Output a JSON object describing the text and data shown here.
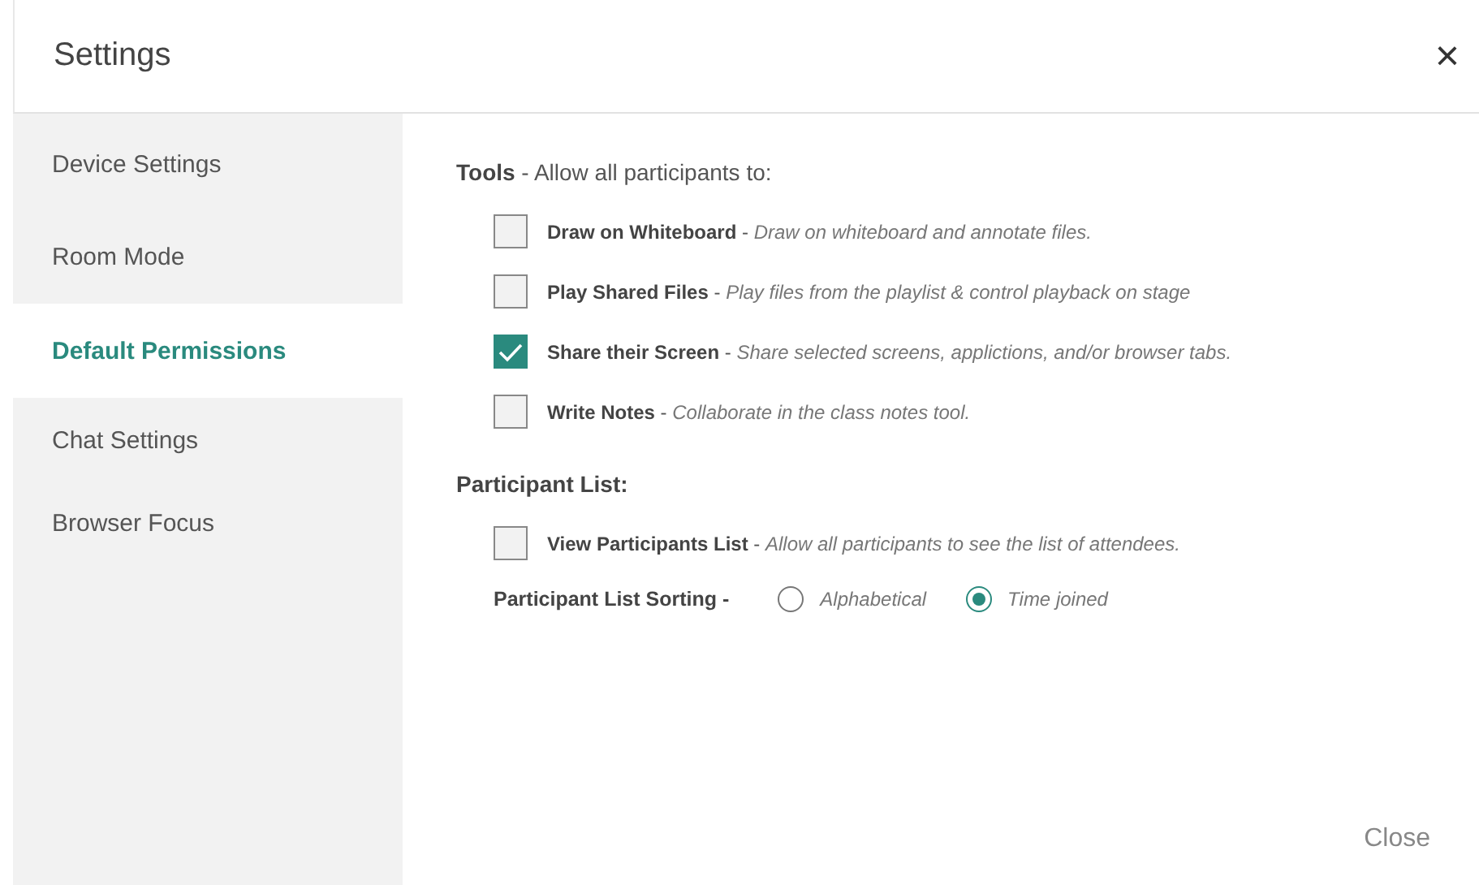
{
  "window": {
    "title": "Settings",
    "close_icon": "×"
  },
  "sidebar": {
    "items": [
      {
        "label": "Device Settings",
        "selected": false
      },
      {
        "label": "Room Mode",
        "selected": false
      },
      {
        "label": "Default Permissions",
        "selected": true
      },
      {
        "label": "Chat Settings",
        "selected": false
      },
      {
        "label": "Browser Focus",
        "selected": false
      }
    ]
  },
  "sections": [
    {
      "heading": "**Tools** - Allow all participants to:",
      "rows": [
        {
          "kind": "checkbox",
          "text": "**Draw on Whiteboard** - *Draw on whiteboard and annotate files.*",
          "checked": false
        },
        {
          "kind": "checkbox",
          "text": "**Play Shared Files** - *Play files from the playlist & control playback on stage*",
          "checked": false
        },
        {
          "kind": "checkbox",
          "text": "**Share their Screen** - *Share selected screens, applictions, and/or browser tabs.*",
          "checked": true
        },
        {
          "kind": "checkbox",
          "text": "**Write Notes** - *Collaborate in the class notes tool.*",
          "checked": false
        }
      ]
    },
    {
      "heading": "**Participant List:**",
      "rows": [
        {
          "kind": "checkbox",
          "text": "**View Participants List** - *Allow all participants to see the list  of attendees.*",
          "checked": false
        },
        {
          "kind": "radio",
          "label": "Participant List Sorting -",
          "options": [
            {
              "label": "Alphabetical",
              "selected": false
            },
            {
              "label": "Time joined",
              "selected": true
            }
          ]
        }
      ]
    }
  ],
  "footer": {
    "button": "Close"
  }
}
